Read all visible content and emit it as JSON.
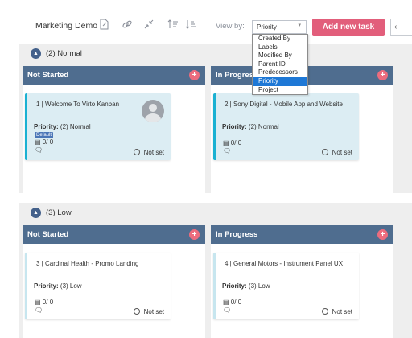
{
  "toolbar": {
    "board_title": "Marketing Demo",
    "icons": [
      "edit-icon",
      "link-icon",
      "collapse-icon",
      "sort-ascending-icon",
      "sort-descending-icon"
    ],
    "view_by_label": "View by:",
    "view_by_value": "Priority",
    "add_task_label": "Add new task"
  },
  "view_by_dropdown": {
    "options": [
      "Created By",
      "Labels",
      "Modified By",
      "Parent ID",
      "Predecessors",
      "Priority",
      "Project"
    ],
    "selected": "Priority"
  },
  "groups": [
    {
      "name": "(2) Normal",
      "columns": [
        {
          "title": "Not Started",
          "card": {
            "title": "1 | Welcome To Virto Kanban",
            "priority_label": "Priority:",
            "priority_value": "(2) Normal",
            "label_tag": "Default",
            "subtasks": "0/ 0",
            "due": "Not set",
            "has_avatar": true
          }
        },
        {
          "title": "In Progress",
          "card": {
            "title": "2 | Sony Digital - Mobile App and Website",
            "priority_label": "Priority:",
            "priority_value": "(2) Normal",
            "subtasks": "0/ 0",
            "due": "Not set"
          }
        }
      ]
    },
    {
      "name": "(3) Low",
      "columns": [
        {
          "title": "Not Started",
          "card": {
            "title": "3 | Cardinal Health - Promo Landing",
            "priority_label": "Priority:",
            "priority_value": "(3) Low",
            "subtasks": "0/ 0",
            "due": "Not set"
          }
        },
        {
          "title": "In Progress",
          "card": {
            "title": "4 | General Motors - Instrument Panel UX",
            "priority_label": "Priority:",
            "priority_value": "(3) Low",
            "subtasks": "0/ 0",
            "due": "Not set"
          }
        }
      ]
    }
  ],
  "colors": {
    "column_header": "#4f6d8f",
    "add_button": "#e25e7b",
    "card_accent": "#1bb1d2",
    "dropdown_selected": "#1e78d6"
  }
}
